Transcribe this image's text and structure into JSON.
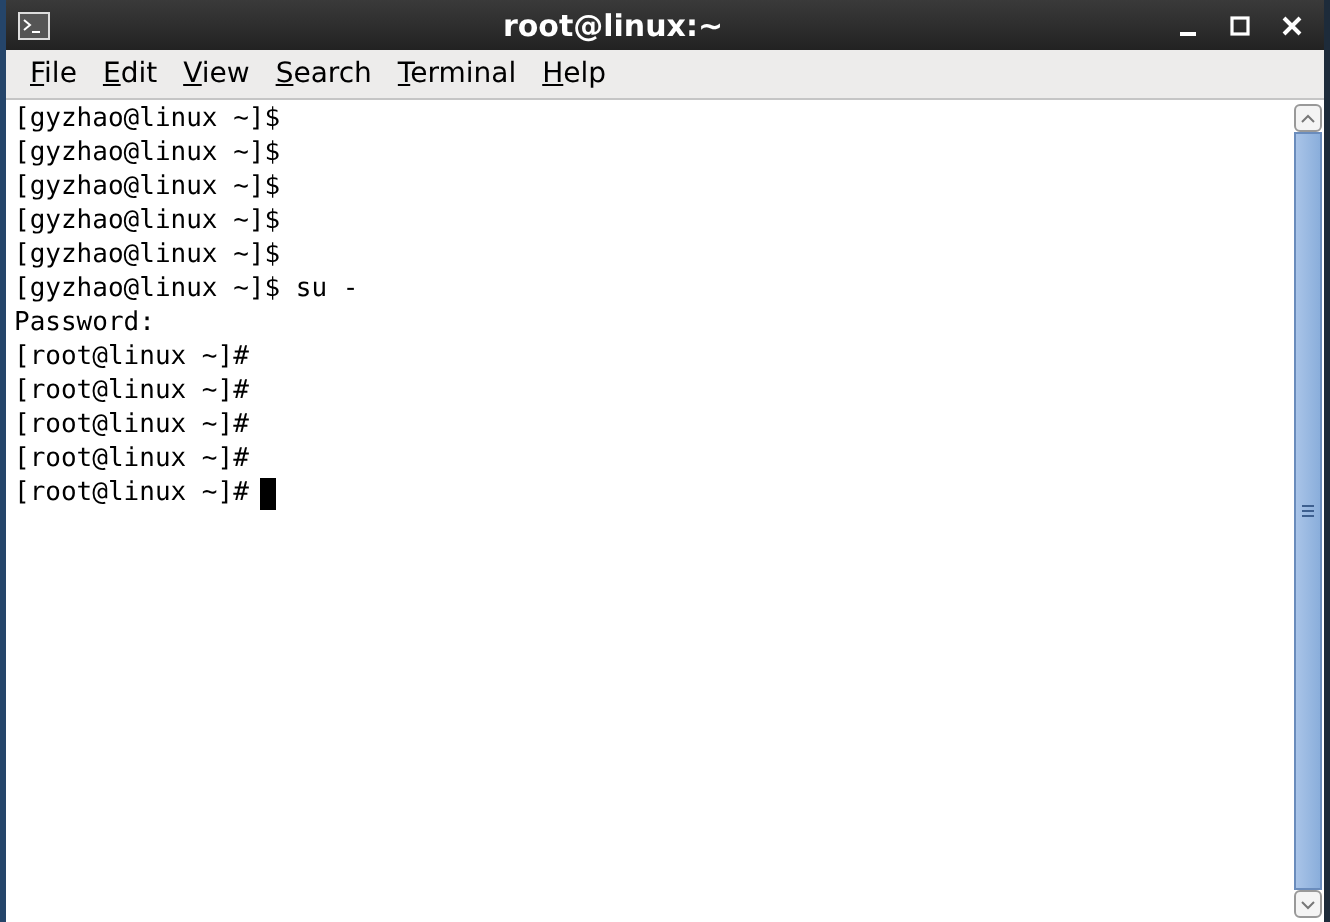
{
  "window": {
    "title": "root@linux:~"
  },
  "menu": [
    "File",
    "Edit",
    "View",
    "Search",
    "Terminal",
    "Help"
  ],
  "terminal": {
    "lines": [
      "[gyzhao@linux ~]$",
      "[gyzhao@linux ~]$",
      "[gyzhao@linux ~]$",
      "[gyzhao@linux ~]$",
      "[gyzhao@linux ~]$",
      "[gyzhao@linux ~]$ su -",
      "Password:",
      "[root@linux ~]#",
      "[root@linux ~]#",
      "[root@linux ~]#",
      "[root@linux ~]#",
      "[root@linux ~]#"
    ]
  }
}
